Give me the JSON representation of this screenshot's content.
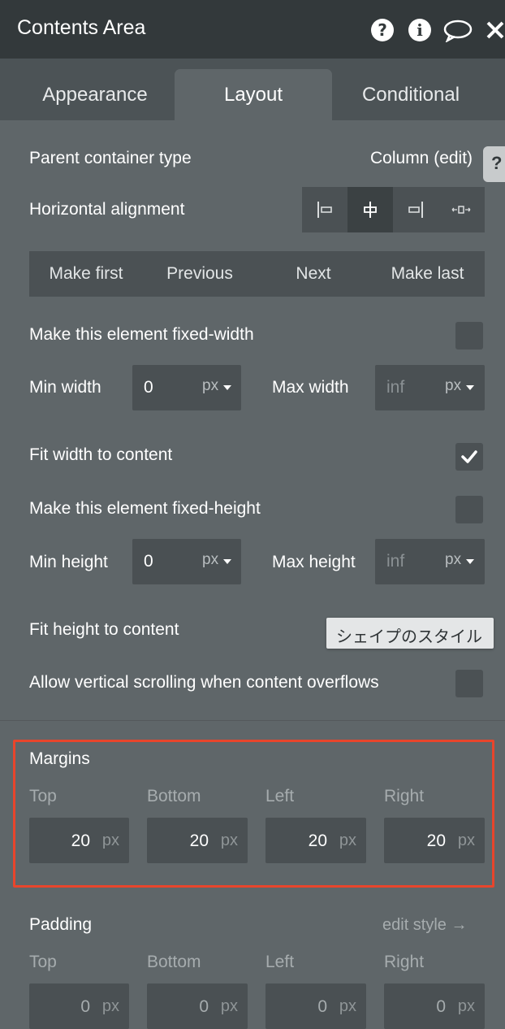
{
  "header": {
    "title": "Contents Area",
    "icons": [
      "help-circle-icon",
      "info-circle-icon",
      "comment-icon",
      "close-icon"
    ]
  },
  "tabs": [
    {
      "label": "Appearance",
      "active": false
    },
    {
      "label": "Layout",
      "active": true
    },
    {
      "label": "Conditional",
      "active": false
    }
  ],
  "side_help": "?",
  "parent_container": {
    "label": "Parent container type",
    "value": "Column (edit)"
  },
  "horizontal_alignment": {
    "label": "Horizontal alignment",
    "options": [
      "align-left-icon",
      "align-center-icon",
      "align-right-icon",
      "align-stretch-icon"
    ],
    "selected_index": 1
  },
  "order_buttons": [
    "Make first",
    "Previous",
    "Next",
    "Make last"
  ],
  "fixed_width": {
    "label": "Make this element fixed-width",
    "checked": false
  },
  "min_width": {
    "label": "Min width",
    "value": "0",
    "unit": "px"
  },
  "max_width": {
    "label": "Max width",
    "placeholder": "inf",
    "unit": "px"
  },
  "fit_width": {
    "label": "Fit width to content",
    "checked": true
  },
  "fixed_height": {
    "label": "Make this element fixed-height",
    "checked": false
  },
  "min_height": {
    "label": "Min height",
    "value": "0",
    "unit": "px"
  },
  "max_height": {
    "label": "Max height",
    "placeholder": "inf",
    "unit": "px"
  },
  "fit_height": {
    "label": "Fit height to content"
  },
  "tooltip": "シェイプのスタイル",
  "vertical_scroll": {
    "label": "Allow vertical scrolling when content overflows",
    "checked": false
  },
  "margins": {
    "title": "Margins",
    "highlight_color": "#e8452c",
    "fields": [
      {
        "label": "Top",
        "value": "20",
        "unit": "px"
      },
      {
        "label": "Bottom",
        "value": "20",
        "unit": "px"
      },
      {
        "label": "Left",
        "value": "20",
        "unit": "px"
      },
      {
        "label": "Right",
        "value": "20",
        "unit": "px"
      }
    ]
  },
  "padding": {
    "title": "Padding",
    "edit_link": "edit style →",
    "fields": [
      {
        "label": "Top",
        "value": "0",
        "unit": "px"
      },
      {
        "label": "Bottom",
        "value": "0",
        "unit": "px"
      },
      {
        "label": "Left",
        "value": "0",
        "unit": "px"
      },
      {
        "label": "Right",
        "value": "0",
        "unit": "px"
      }
    ]
  }
}
